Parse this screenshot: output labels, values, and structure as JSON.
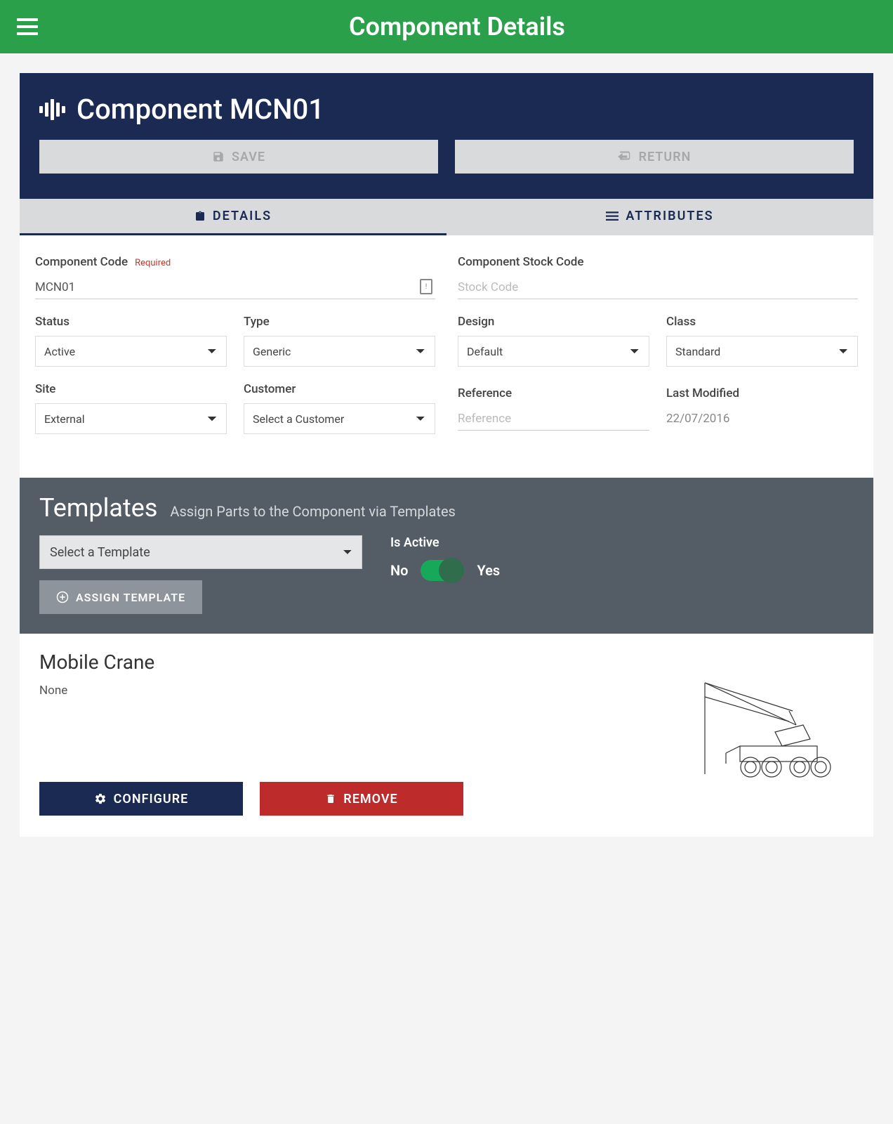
{
  "header": {
    "title": "Component Details"
  },
  "panel": {
    "title": "Component MCN01",
    "save_label": "SAVE",
    "return_label": "RETURN"
  },
  "tabs": {
    "details": "DETAILS",
    "attributes": "ATTRIBUTES"
  },
  "form": {
    "component_code": {
      "label": "Component Code",
      "required": "Required",
      "value": "MCN01"
    },
    "stock_code": {
      "label": "Component Stock Code",
      "placeholder": "Stock Code"
    },
    "status": {
      "label": "Status",
      "value": "Active"
    },
    "type": {
      "label": "Type",
      "value": "Generic"
    },
    "design": {
      "label": "Design",
      "value": "Default"
    },
    "class": {
      "label": "Class",
      "value": "Standard"
    },
    "site": {
      "label": "Site",
      "value": "External"
    },
    "customer": {
      "label": "Customer",
      "value": "Select a Customer"
    },
    "reference": {
      "label": "Reference",
      "placeholder": "Reference"
    },
    "last_modified": {
      "label": "Last Modified",
      "value": "22/07/2016"
    }
  },
  "templates": {
    "title": "Templates",
    "subtitle": "Assign Parts to the Component via Templates",
    "select_placeholder": "Select a Template",
    "assign_label": "ASSIGN TEMPLATE",
    "is_active_label": "Is Active",
    "no_label": "No",
    "yes_label": "Yes"
  },
  "assigned": {
    "title": "Mobile Crane",
    "desc": "None",
    "configure_label": "CONFIGURE",
    "remove_label": "REMOVE"
  }
}
